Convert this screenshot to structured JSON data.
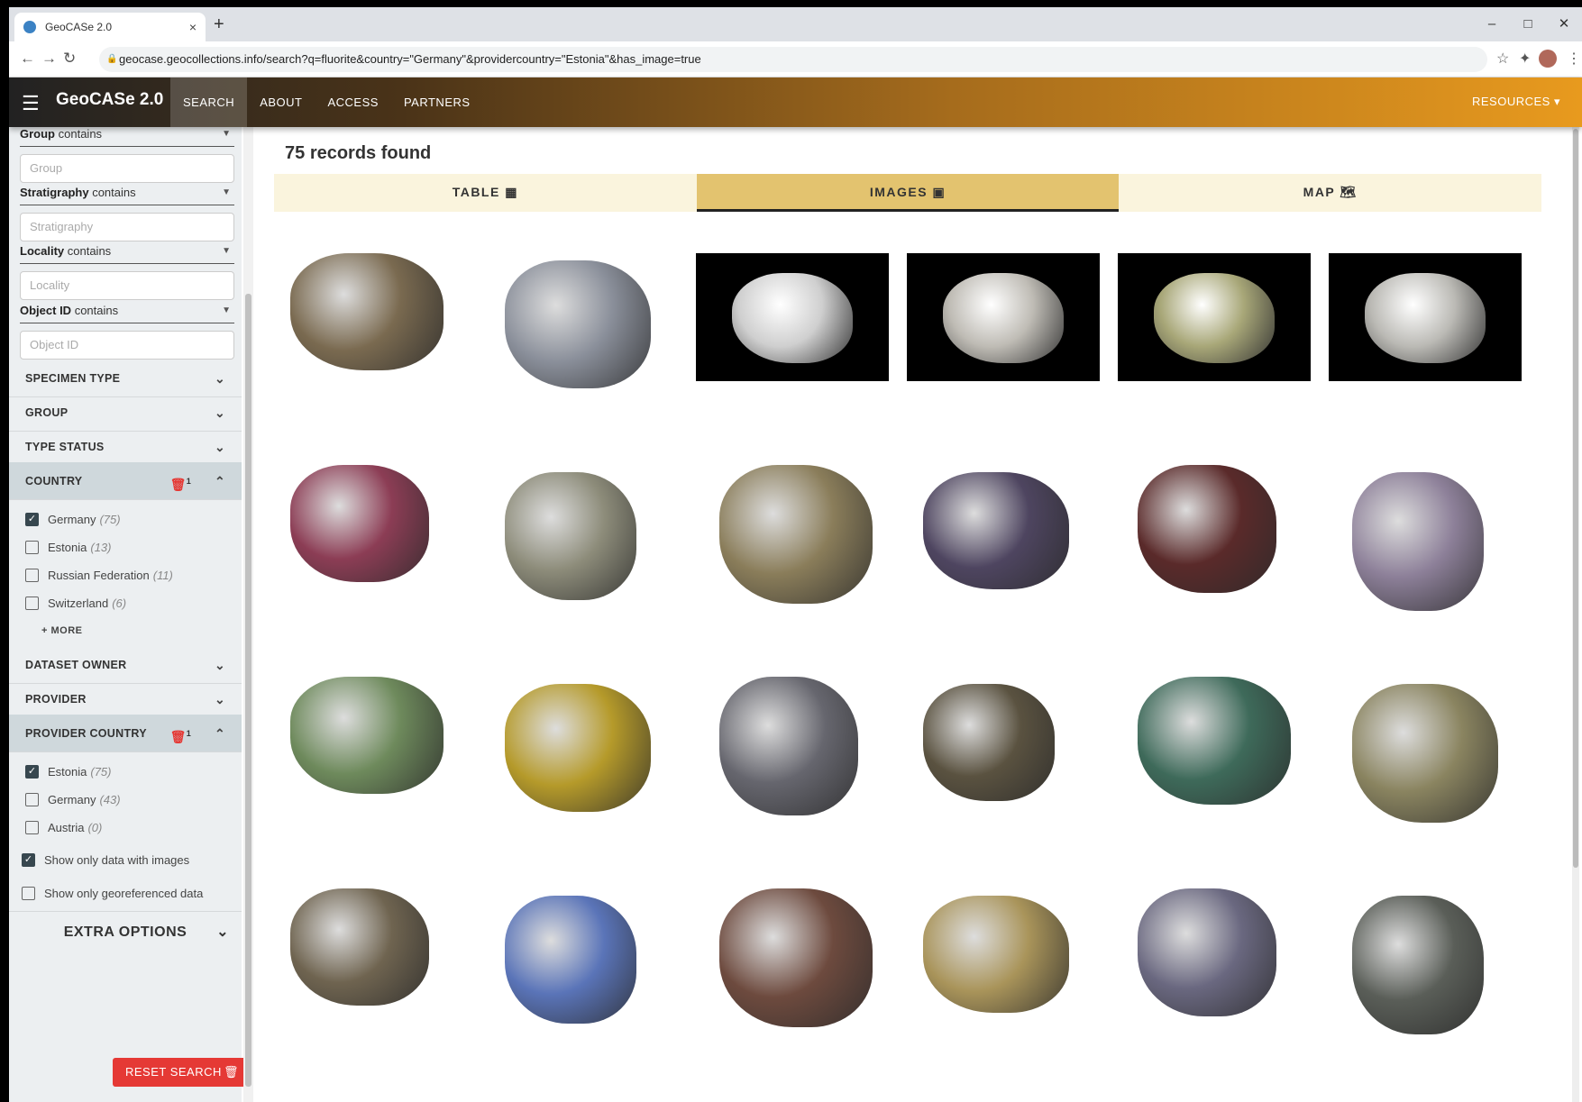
{
  "browser": {
    "tab_title": "GeoCASe 2.0",
    "tab_close": "×",
    "new_tab": "+",
    "url": "geocase.geocollections.info/search?q=fluorite&country=\"Germany\"&providercountry=\"Estonia\"&has_image=true"
  },
  "header": {
    "brand": "GeoCASe 2.0",
    "nav": [
      "SEARCH",
      "ABOUT",
      "ACCESS",
      "PARTNERS"
    ],
    "resources": "RESOURCES ▾"
  },
  "filters": {
    "fields": [
      {
        "label": "Group",
        "op": "contains",
        "placeholder": "Group"
      },
      {
        "label": "Stratigraphy",
        "op": "contains",
        "placeholder": "Stratigraphy"
      },
      {
        "label": "Locality",
        "op": "contains",
        "placeholder": "Locality"
      },
      {
        "label": "Object ID",
        "op": "contains",
        "placeholder": "Object ID"
      }
    ],
    "sections": {
      "specimen_type": "SPECIMEN TYPE",
      "group": "GROUP",
      "type_status": "TYPE STATUS",
      "country": "COUNTRY",
      "dataset_owner": "DATASET OWNER",
      "provider": "PROVIDER",
      "provider_country": "PROVIDER COUNTRY"
    },
    "badge_count": "1",
    "country_options": [
      {
        "name": "Germany",
        "count": "(75)",
        "checked": true
      },
      {
        "name": "Estonia",
        "count": "(13)",
        "checked": false
      },
      {
        "name": "Russian Federation",
        "count": "(11)",
        "checked": false
      },
      {
        "name": "Switzerland",
        "count": "(6)",
        "checked": false
      }
    ],
    "more": "+ MORE",
    "provider_country_options": [
      {
        "name": "Estonia",
        "count": "(75)",
        "checked": true
      },
      {
        "name": "Germany",
        "count": "(43)",
        "checked": false
      },
      {
        "name": "Austria",
        "count": "(0)",
        "checked": false
      }
    ],
    "only_images": "Show only data with images",
    "only_images_checked": true,
    "only_geo": "Show only georeferenced data",
    "only_geo_checked": false,
    "extra_options": "EXTRA OPTIONS",
    "reset": "RESET SEARCH"
  },
  "results": {
    "count_number": "75",
    "count_text": "records found",
    "tabs": [
      "TABLE",
      "IMAGES",
      "MAP"
    ],
    "active_tab": "IMAGES",
    "images": [
      {
        "color": "#7a6a50",
        "bg": "white"
      },
      {
        "color": "#8a8f9a",
        "bg": "white"
      },
      {
        "color": "#cfcfcf",
        "bg": "black"
      },
      {
        "color": "#bfbcb5",
        "bg": "black"
      },
      {
        "color": "#a8a778",
        "bg": "black"
      },
      {
        "color": "#bbbab5",
        "bg": "black"
      },
      {
        "color": "#8c3d55",
        "bg": "white"
      },
      {
        "color": "#8d8c7a",
        "bg": "white"
      },
      {
        "color": "#8a7d5a",
        "bg": "white"
      },
      {
        "color": "#4e4560",
        "bg": "white"
      },
      {
        "color": "#5a2a2a",
        "bg": "white"
      },
      {
        "color": "#8d8099",
        "bg": "white"
      },
      {
        "color": "#6e8a5c",
        "bg": "white"
      },
      {
        "color": "#b59a2a",
        "bg": "white"
      },
      {
        "color": "#66666e",
        "bg": "white"
      },
      {
        "color": "#5a5240",
        "bg": "white"
      },
      {
        "color": "#3e6a5a",
        "bg": "white"
      },
      {
        "color": "#8a8460",
        "bg": "white"
      },
      {
        "color": "#6f6450",
        "bg": "white"
      },
      {
        "color": "#5a74b8",
        "bg": "white"
      },
      {
        "color": "#6d4a3e",
        "bg": "white"
      },
      {
        "color": "#a9945a",
        "bg": "white"
      },
      {
        "color": "#6a6880",
        "bg": "white"
      },
      {
        "color": "#5a5e58",
        "bg": "white"
      }
    ]
  }
}
